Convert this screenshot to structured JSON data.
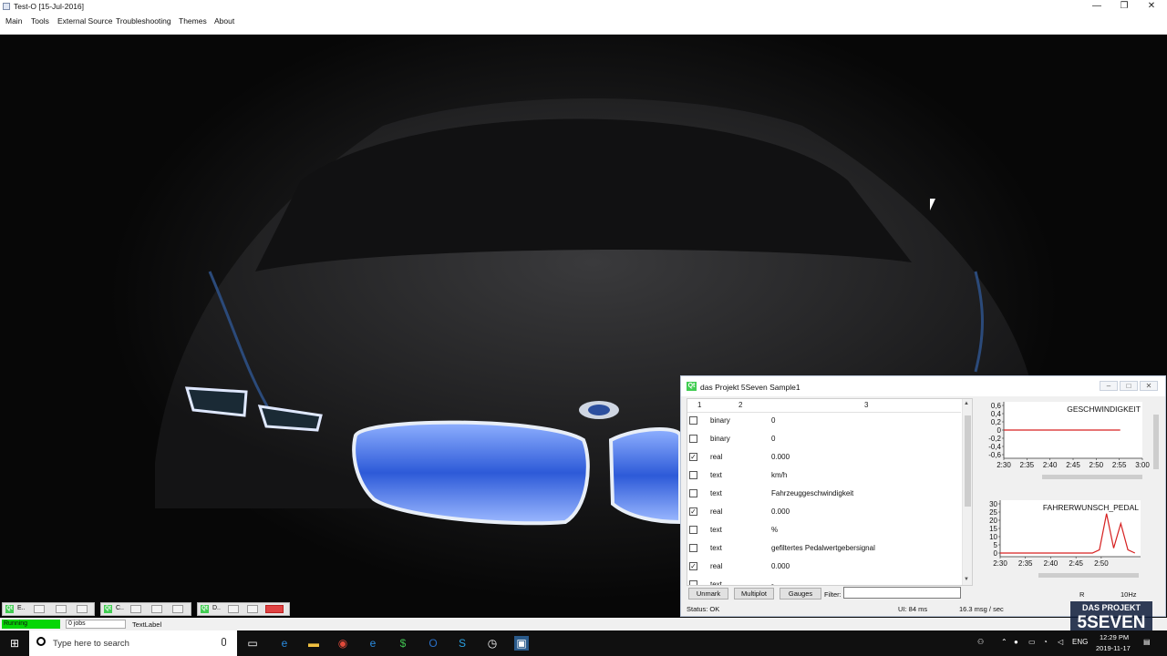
{
  "window": {
    "title": "Test-O [15-Jul-2016]",
    "minimize": "—",
    "maximize": "❐",
    "close": "✕"
  },
  "menu": [
    "Main",
    "Tools",
    "External Source",
    "Troubleshooting",
    "Themes",
    "About"
  ],
  "child": {
    "title": "das Projekt 5Seven Sample1",
    "columns": [
      "1",
      "2",
      "3"
    ],
    "rows": [
      {
        "checked": false,
        "type": "binary",
        "value": "0"
      },
      {
        "checked": false,
        "type": "binary",
        "value": "0"
      },
      {
        "checked": true,
        "type": "real",
        "value": "0.000"
      },
      {
        "checked": false,
        "type": "text",
        "value": "km/h"
      },
      {
        "checked": false,
        "type": "text",
        "value": "Fahrzeuggeschwindigkeit"
      },
      {
        "checked": true,
        "type": "real",
        "value": "0.000"
      },
      {
        "checked": false,
        "type": "text",
        "value": "%"
      },
      {
        "checked": false,
        "type": "text",
        "value": "gefiltertes Pedalwertgebersignal"
      },
      {
        "checked": true,
        "type": "real",
        "value": "0.000"
      },
      {
        "checked": false,
        "type": "text",
        "value": "-"
      }
    ],
    "buttons": {
      "unmark": "Unmark",
      "multiplot": "Multiplot",
      "gauges": "Gauges"
    },
    "filter_label": "Filter:",
    "filter_value": "",
    "status": "Status: OK",
    "ui_time": "UI:  84 ms",
    "rate": "16.3 msg / sec",
    "freq_partial": "10Hz",
    "r_partial": "R"
  },
  "chart_data": [
    {
      "type": "line",
      "title": "GESCHWINDIGKEIT",
      "x_ticks": [
        "2:30",
        "2:35",
        "2:40",
        "2:45",
        "2:50",
        "2:55",
        "3:00"
      ],
      "y_ticks": [
        "0,6",
        "0,4",
        "0,2",
        "0",
        "-0,2",
        "-0,4",
        "-0,6"
      ],
      "ylim": [
        -0.6,
        0.6
      ],
      "series": [
        {
          "values": [
            0,
            0,
            0,
            0,
            0,
            0,
            0
          ],
          "color": "#d62020"
        }
      ]
    },
    {
      "type": "line",
      "title": "FAHRERWUNSCH_PEDAL",
      "x_ticks": [
        "2:30",
        "2:35",
        "2:40",
        "2:45",
        "2:50"
      ],
      "y_ticks": [
        "30",
        "25",
        "20",
        "15",
        "10",
        "5",
        "0"
      ],
      "ylim": [
        0,
        30
      ],
      "series": [
        {
          "values": [
            0,
            0,
            0,
            0,
            0,
            0,
            0,
            0,
            0,
            0,
            0,
            0,
            0,
            0,
            2,
            24,
            3,
            18,
            2,
            0
          ],
          "color": "#d62020"
        }
      ]
    }
  ],
  "bottom": {
    "mini_windows": [
      "E..",
      "C..",
      "D.."
    ],
    "run_state": "Running",
    "jobs": "0 jobs",
    "text_label": "TextLabel"
  },
  "taskbar": {
    "search_placeholder": "Type here to search",
    "lang": "ENG",
    "time": "12:29 PM",
    "date": "2019-11-17"
  },
  "watermark": {
    "line1": "DAS PROJEKT",
    "line2": "5SEVEN"
  },
  "colors": {
    "accent": "#41cd52",
    "running": "#06d606",
    "plot_line": "#d62020"
  }
}
